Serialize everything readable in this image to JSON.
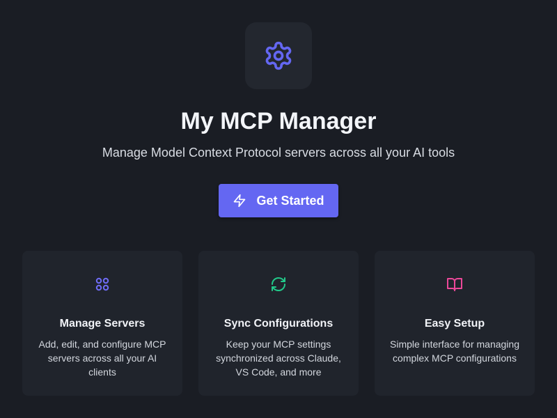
{
  "app": {
    "title": "My MCP Manager",
    "subtitle": "Manage Model Context Protocol servers across all your AI tools",
    "logo_icon": "gear-icon"
  },
  "cta": {
    "label": "Get Started",
    "icon": "lightning-bolt-icon"
  },
  "features": [
    {
      "icon": "grid-circles-icon",
      "icon_color": "#6f6cf6",
      "title": "Manage Servers",
      "description": "Add, edit, and configure MCP servers across all your AI clients"
    },
    {
      "icon": "refresh-icon",
      "icon_color": "#22c98a",
      "title": "Sync Configurations",
      "description": "Keep your MCP settings synchronized across Claude, VS Code, and more"
    },
    {
      "icon": "open-book-icon",
      "icon_color": "#ec4899",
      "title": "Easy Setup",
      "description": "Simple interface for managing complex MCP configurations"
    }
  ],
  "colors": {
    "background": "#1a1d24",
    "card": "#20242c",
    "accent": "#6467f2"
  }
}
